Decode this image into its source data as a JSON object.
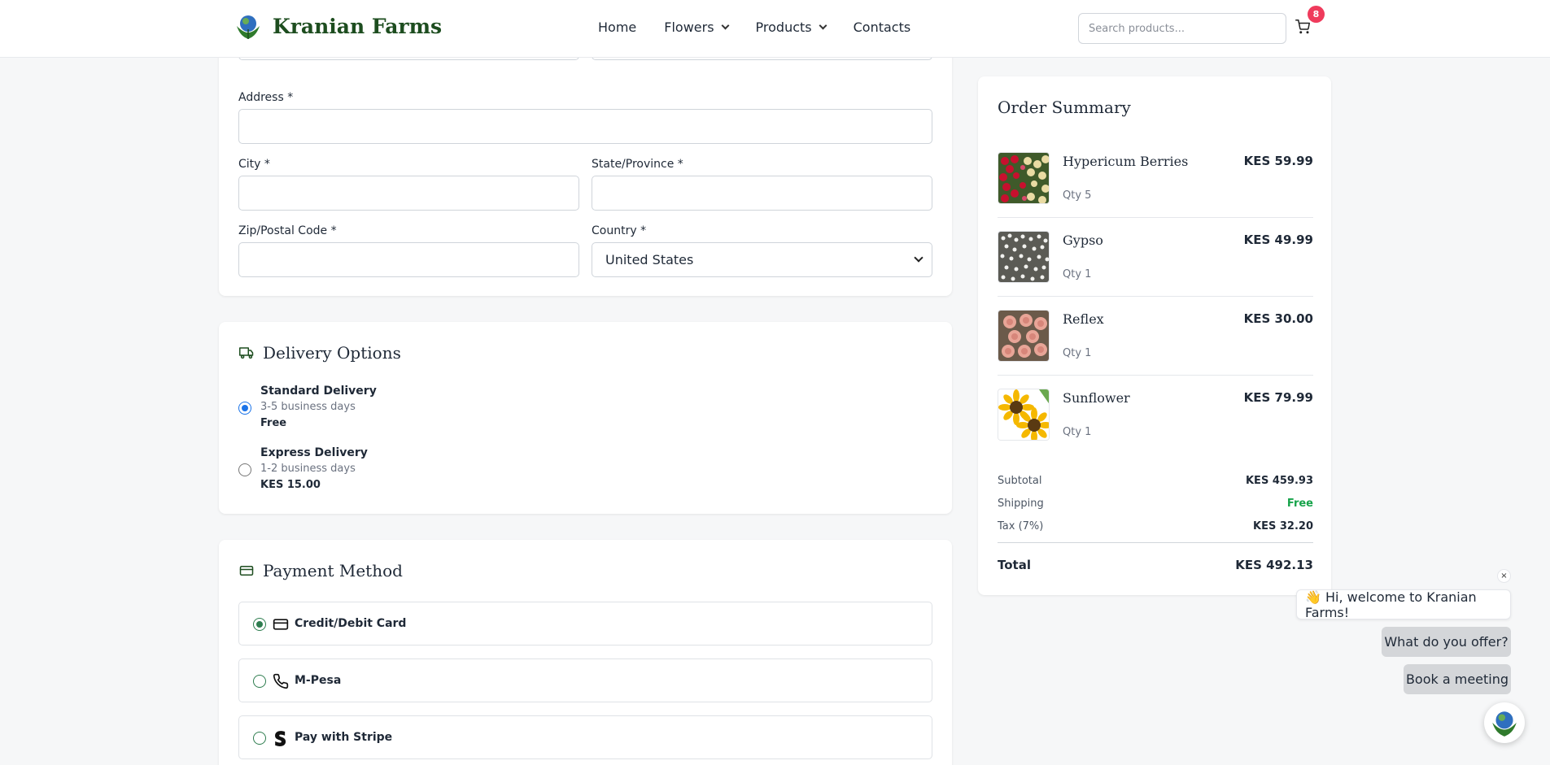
{
  "header": {
    "brand": "Kranian Farms",
    "nav": [
      {
        "label": "Home",
        "has_menu": false
      },
      {
        "label": "Flowers",
        "has_menu": true
      },
      {
        "label": "Products",
        "has_menu": true
      },
      {
        "label": "Contacts",
        "has_menu": false
      }
    ],
    "search_placeholder": "Search products...",
    "cart_count": "8"
  },
  "address_form": {
    "address_label": "Address *",
    "city_label": "City *",
    "state_label": "State/Province *",
    "zip_label": "Zip/Postal Code *",
    "country_label": "Country *",
    "country_value": "United States"
  },
  "delivery": {
    "title": "Delivery Options",
    "options": [
      {
        "name": "Standard Delivery",
        "time": "3-5 business days",
        "price": "Free",
        "selected": true
      },
      {
        "name": "Express Delivery",
        "time": "1-2 business days",
        "price": "KES 15.00",
        "selected": false
      }
    ]
  },
  "payment": {
    "title": "Payment Method",
    "options": [
      {
        "label": "Credit/Debit Card",
        "icon": "credit-card-icon",
        "selected": true
      },
      {
        "label": "M-Pesa",
        "icon": "phone-icon",
        "selected": false
      },
      {
        "label": "Pay with Stripe",
        "icon": "stripe-icon",
        "selected": false
      }
    ]
  },
  "summary": {
    "title": "Order Summary",
    "items": [
      {
        "name": "Hypericum Berries",
        "qty": "Qty 5",
        "price": "KES 59.99"
      },
      {
        "name": "Gypso",
        "qty": "Qty 1",
        "price": "KES 49.99"
      },
      {
        "name": "Reflex",
        "qty": "Qty 1",
        "price": "KES 30.00"
      },
      {
        "name": "Sunflower",
        "qty": "Qty 1",
        "price": "KES 79.99"
      }
    ],
    "subtotal_label": "Subtotal",
    "subtotal_value": "KES 459.93",
    "shipping_label": "Shipping",
    "shipping_value": "Free",
    "tax_label": "Tax (7%)",
    "tax_value": "KES 32.20",
    "total_label": "Total",
    "total_value": "KES 492.13"
  },
  "chat": {
    "welcome": "👋 Hi, welcome to Kranian Farms!",
    "quick_replies": [
      "What do you offer?",
      "Book a meeting"
    ],
    "close": "×"
  },
  "colors": {
    "brand_green": "#1d4d1f",
    "badge_red": "#ef3b5c",
    "radio_blue": "#1a73e8",
    "free_green": "#16a34a"
  }
}
